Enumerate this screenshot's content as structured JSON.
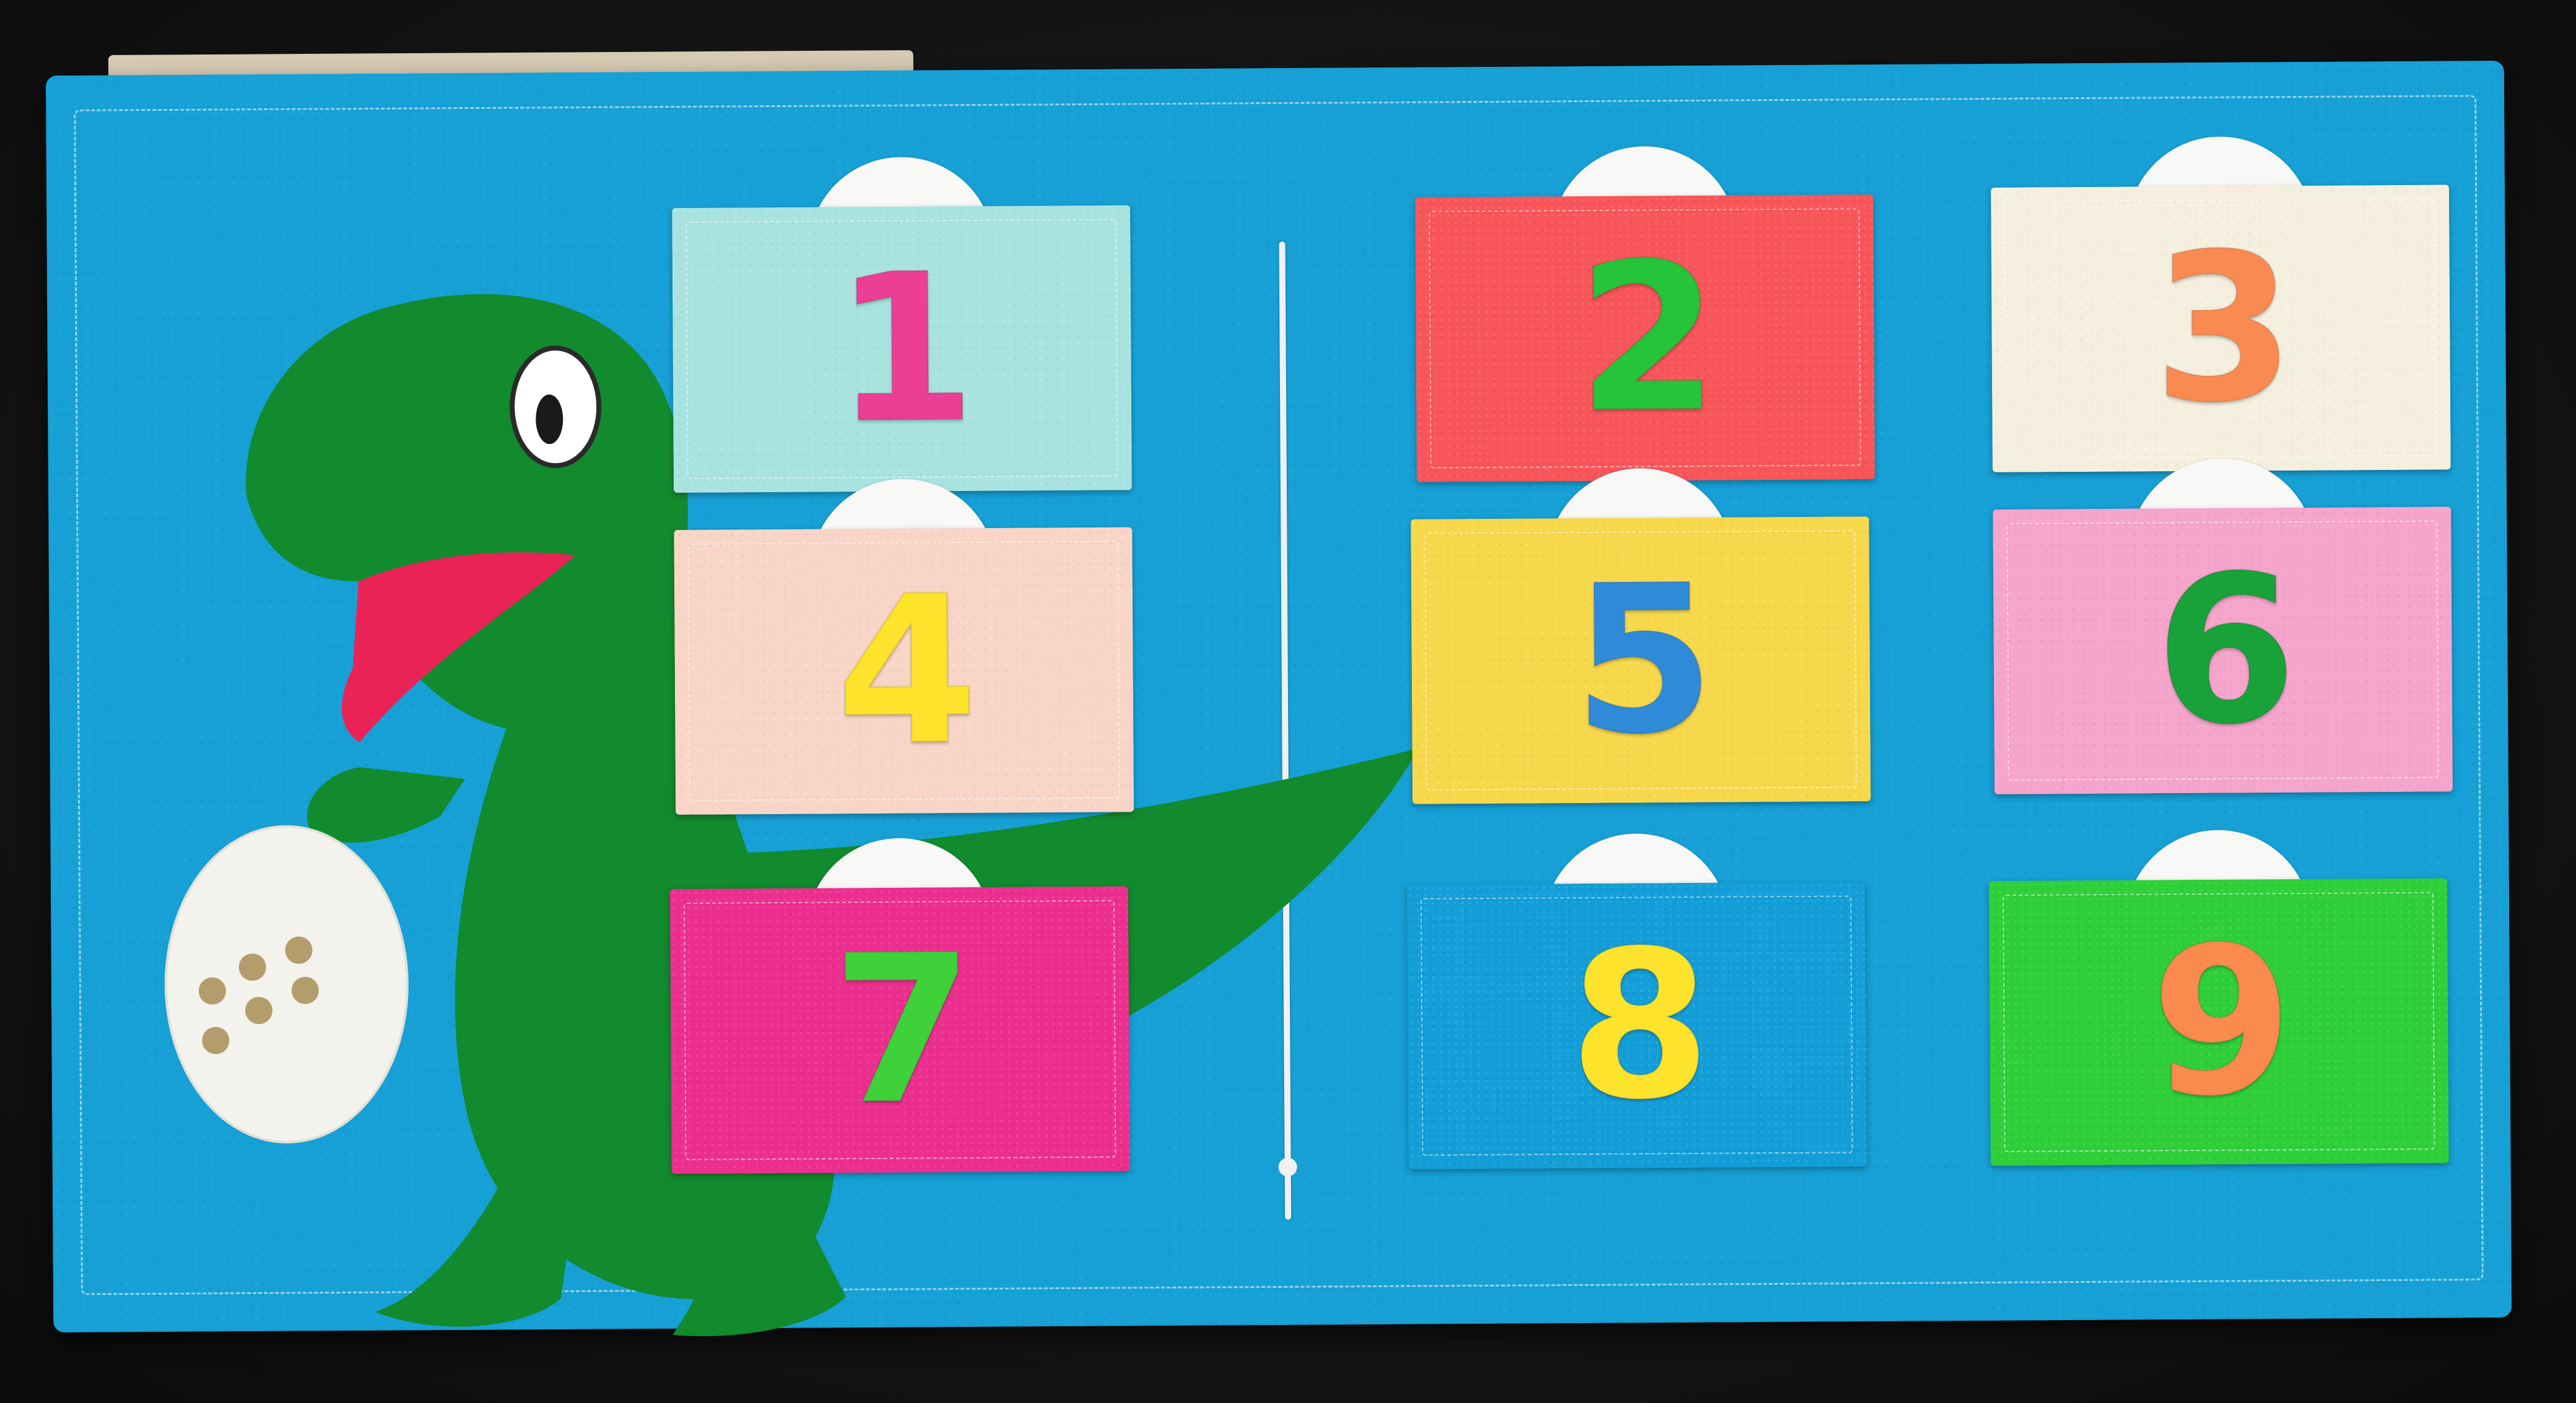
{
  "scene": {
    "background_color": "#141414",
    "board_color": "#16a0d6",
    "stitch_color": "#f5f5f5",
    "cord_color": "#f1f1f1"
  },
  "decorations": {
    "dinosaur": {
      "icon": "dinosaur-icon",
      "body_color": "#128a2e",
      "mouth_color": "#ea2356",
      "eye_color": "#ffffff"
    },
    "egg": {
      "icon": "egg-icon",
      "shell_color": "#f3f2ec",
      "spot_color": "#b49d6c",
      "spot_count": 6
    }
  },
  "pockets": [
    {
      "number": "1",
      "pocket_color": "#a8e3df",
      "numeral_color": "#ea3f94",
      "tab_color": "#f8f8f6"
    },
    {
      "number": "2",
      "pocket_color": "#f8555a",
      "numeral_color": "#26c43a",
      "tab_color": "#f8f8f6"
    },
    {
      "number": "3",
      "pocket_color": "#f4efde",
      "numeral_color": "#f98b52",
      "tab_color": "#f8f8f6"
    },
    {
      "number": "4",
      "pocket_color": "#f8d5c6",
      "numeral_color": "#fde32b",
      "tab_color": "#f8f8f6"
    },
    {
      "number": "5",
      "pocket_color": "#f8d84b",
      "numeral_color": "#2f8ad8",
      "tab_color": "#f8f8f6"
    },
    {
      "number": "6",
      "pocket_color": "#f5a4cb",
      "numeral_color": "#1aa23a",
      "tab_color": "#f8f8f6"
    },
    {
      "number": "7",
      "pocket_color": "#ec2f8f",
      "numeral_color": "#3ed13a",
      "tab_color": "#f8f8f6"
    },
    {
      "number": "8",
      "pocket_color": "#139ed8",
      "numeral_color": "#fde32b",
      "tab_color": "#f8f8f6"
    },
    {
      "number": "9",
      "pocket_color": "#2fcf3a",
      "numeral_color": "#fb8a4f",
      "tab_color": "#f8f8f6"
    }
  ]
}
